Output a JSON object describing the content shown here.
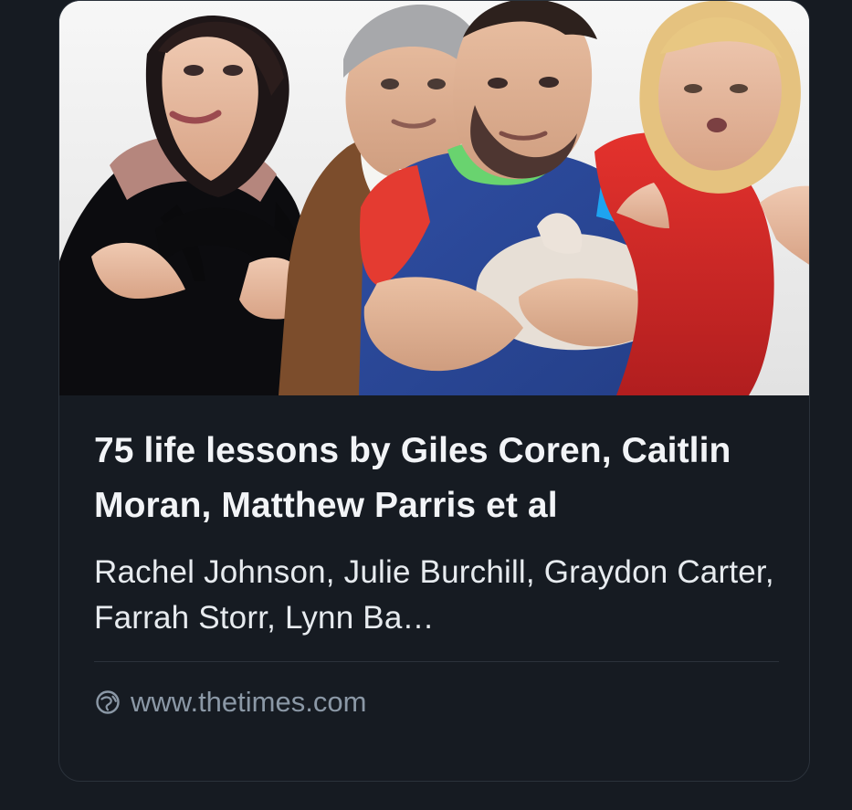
{
  "card": {
    "image_alt": "Four people posing together, one holding a cat",
    "title": "75 life lessons by Giles Coren, Caitlin Moran, Matthew Parris et al",
    "description": "Rachel Johnson, Julie Burchill, Graydon Carter, Farrah Storr, Lynn Ba…",
    "domain": "www.thetimes.com",
    "icon": "globe-icon"
  },
  "colors": {
    "background": "#161b22",
    "title": "#f2f4f7",
    "description": "#e7ebef",
    "source": "#8b98a6",
    "divider": "#2b323b"
  }
}
